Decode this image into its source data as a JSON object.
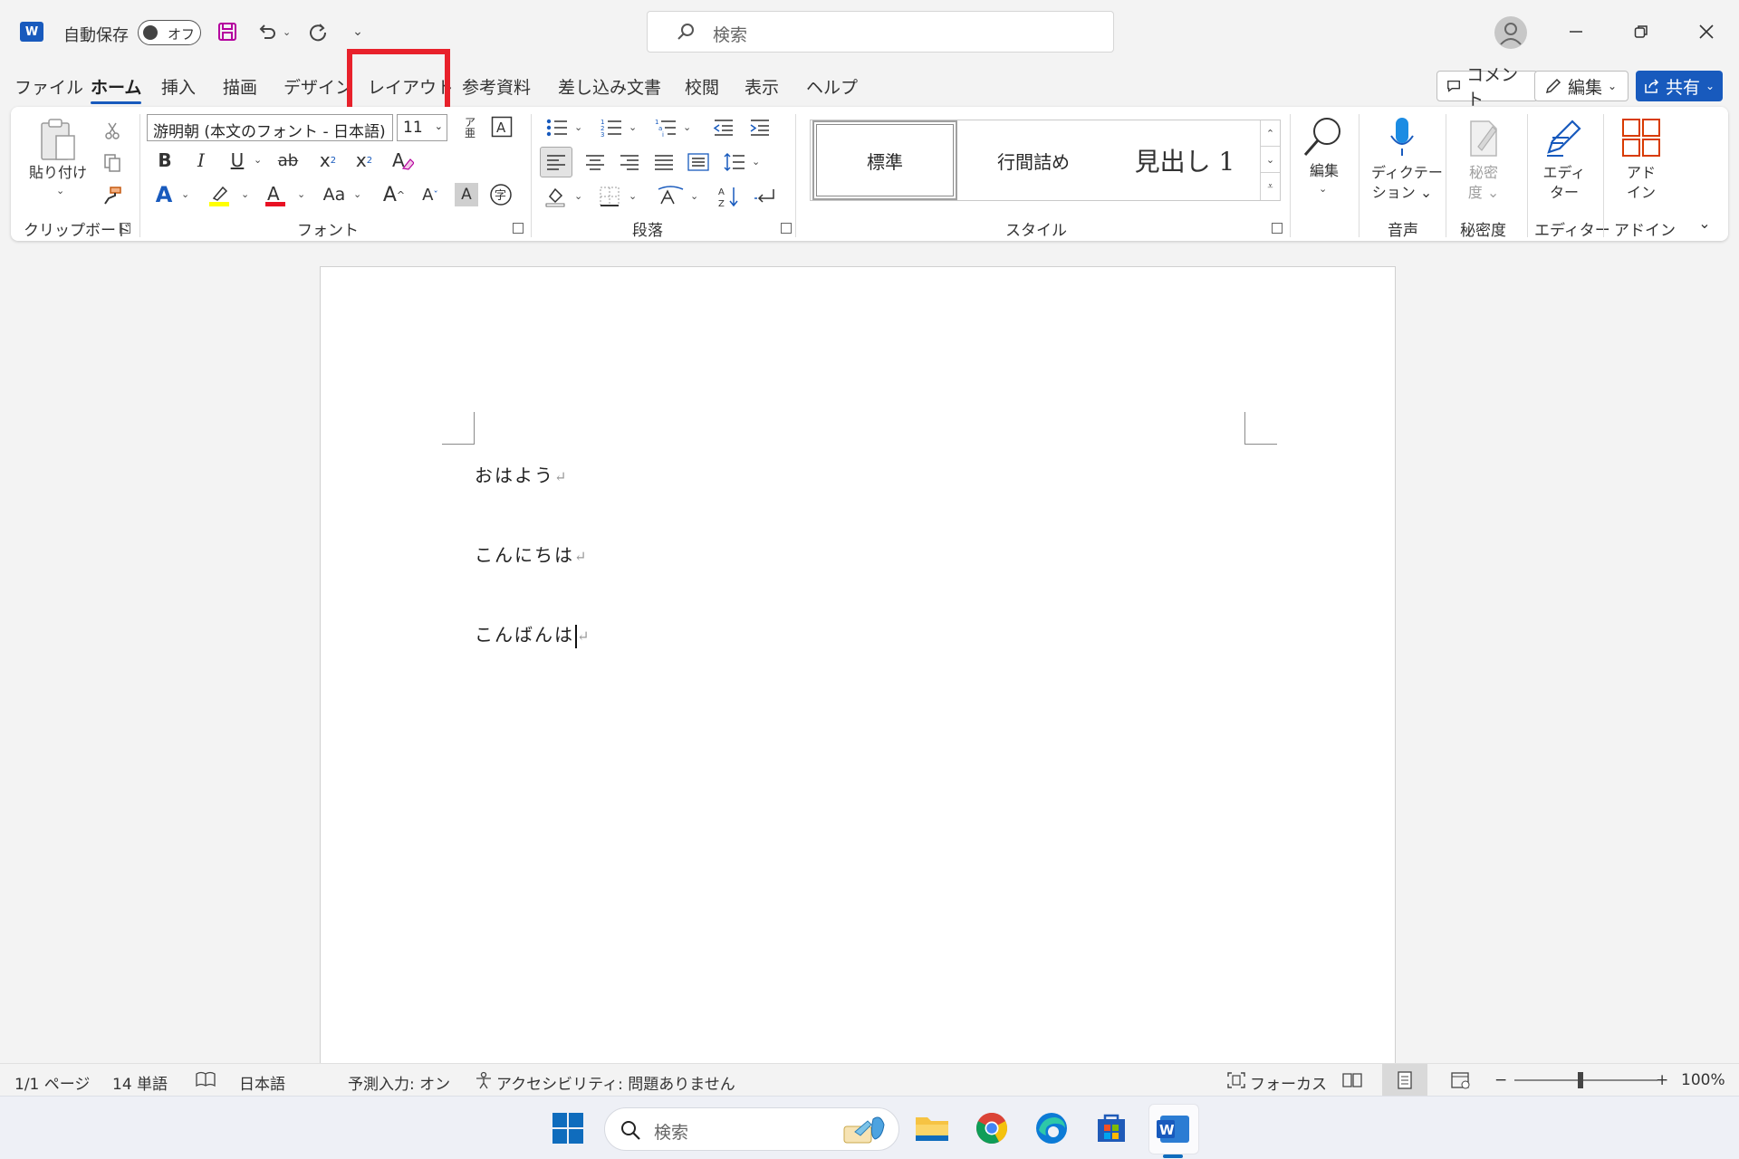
{
  "titlebar": {
    "autosave_label": "自動保存",
    "autosave_state": "オフ",
    "search_placeholder": "検索"
  },
  "tabs": [
    {
      "label": "ファイル"
    },
    {
      "label": "ホーム"
    },
    {
      "label": "挿入"
    },
    {
      "label": "描画"
    },
    {
      "label": "デザイン"
    },
    {
      "label": "レイアウト"
    },
    {
      "label": "参考資料"
    },
    {
      "label": "差し込み文書"
    },
    {
      "label": "校閲"
    },
    {
      "label": "表示"
    },
    {
      "label": "ヘルプ"
    }
  ],
  "top_buttons": {
    "comment": "コメント",
    "edit": "編集",
    "share": "共有"
  },
  "ribbon": {
    "clipboard": {
      "paste_label": "貼り付け",
      "group": "クリップボード"
    },
    "font": {
      "font_name": "游明朝 (本文のフォント - 日本語)",
      "font_size": "11",
      "group": "フォント",
      "bold": "B",
      "italic": "I",
      "underline": "U",
      "strike": "ab",
      "change_case": "Aa",
      "grow": "A",
      "shrink": "A",
      "highlight_color": "#ffff00",
      "font_color": "#e81123"
    },
    "paragraph": {
      "group": "段落"
    },
    "styles": {
      "group": "スタイル",
      "items": [
        "標準",
        "行間詰め",
        "見出し 1"
      ]
    },
    "editing": {
      "label": "編集"
    },
    "voice": {
      "label_line1": "ディクテー",
      "label_line2": "ション",
      "group": "音声"
    },
    "sensitivity": {
      "label_line1": "秘密",
      "label_line2": "度",
      "group": "秘密度"
    },
    "editor": {
      "label_line1": "エディ",
      "label_line2": "ター",
      "group": "エディター"
    },
    "addins": {
      "label_line1": "アド",
      "label_line2": "イン",
      "group": "アドイン"
    }
  },
  "document": {
    "paragraphs": [
      "おはよう",
      "こんにちは",
      "こんばんは"
    ],
    "paragraph_mark": "↵"
  },
  "statusbar": {
    "page": "1/1 ページ",
    "words": "14 単語",
    "language": "日本語",
    "prediction": "予測入力: オン",
    "accessibility": "アクセシビリティ: 問題ありません",
    "focus": "フォーカス",
    "zoom": "100%"
  },
  "taskbar": {
    "search_placeholder": "検索"
  },
  "colors": {
    "word_blue": "#185abd",
    "highlight_red": "#e8212b"
  }
}
